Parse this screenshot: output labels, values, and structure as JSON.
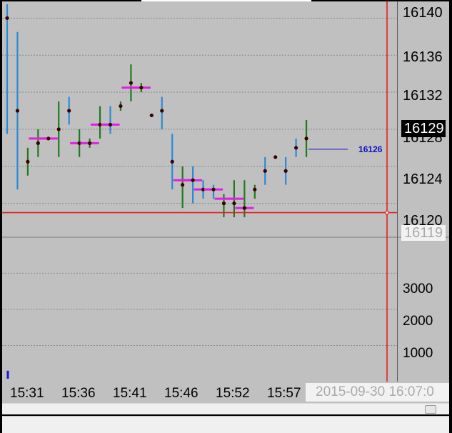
{
  "chart": {
    "price_axis_labels": [
      "16140",
      "16136",
      "16132",
      "16128",
      "16124",
      "16120"
    ],
    "volume_axis_labels": [
      "3000",
      "2000",
      "1000"
    ],
    "time_axis_labels": [
      "15:31",
      "15:36",
      "15:41",
      "15:46",
      "15:52",
      "15:57"
    ],
    "last_price_badge": "16129",
    "crosshair_price_badge": "16119",
    "crosshair_time_badge": "2015-09-30  16:07:0",
    "price_line_label": "16126",
    "colors": {
      "background": "#c0c0c0",
      "up_bar": "#1f7a1f",
      "down_bar": "#2a8ad8",
      "open_close_tick": "#e020e0",
      "crosshair": "#e02020",
      "price_line": "#1010c0",
      "grid": "#8a8a8a"
    }
  },
  "chart_data": {
    "type": "ohlc",
    "price_ylim": [
      16116.5,
      16141.8
    ],
    "price_gridlines": [
      16140,
      16136,
      16132,
      16128,
      16124,
      16120
    ],
    "volume_ylim": [
      0,
      3800
    ],
    "volume_gridlines": [
      3000,
      2000,
      1000
    ],
    "bars": [
      {
        "high": 16141.5,
        "low": 16127.5,
        "close": 16140.0,
        "dir": "down"
      },
      {
        "high": 16138.5,
        "low": 16121.5,
        "close": 16130.0,
        "dir": "down"
      },
      {
        "high": 16126.0,
        "low": 16123.0,
        "close": 16124.5,
        "dir": "up"
      },
      {
        "high": 16128.0,
        "low": 16125.0,
        "close": 16126.5,
        "dir": "up",
        "tick": 16127.0
      },
      {
        "high": 16127.0,
        "low": 16127.0,
        "close": 16127.0,
        "dir": "none",
        "tick": 16127.0
      },
      {
        "high": 16131.0,
        "low": 16125.0,
        "close": 16128.0,
        "dir": "up"
      },
      {
        "high": 16131.5,
        "low": 16128.5,
        "close": 16130.0,
        "dir": "down"
      },
      {
        "high": 16128.0,
        "low": 16125.0,
        "close": 16126.5,
        "dir": "up",
        "tick": 16126.5
      },
      {
        "high": 16127.0,
        "low": 16126.0,
        "close": 16126.5,
        "dir": "up",
        "tick": 16126.5
      },
      {
        "high": 16130.5,
        "low": 16127.0,
        "close": 16128.5,
        "dir": "up",
        "tick": 16128.5
      },
      {
        "high": 16130.5,
        "low": 16127.5,
        "close": 16128.5,
        "dir": "down",
        "tick": 16128.5
      },
      {
        "high": 16131.0,
        "low": 16130.0,
        "close": 16130.5,
        "dir": "up"
      },
      {
        "high": 16135.0,
        "low": 16131.0,
        "close": 16133.0,
        "dir": "up",
        "tick": 16132.5
      },
      {
        "high": 16133.0,
        "low": 16132.0,
        "close": 16132.5,
        "dir": "up",
        "tick": 16132.5
      },
      {
        "high": 16129.5,
        "low": 16129.5,
        "close": 16129.5,
        "dir": "none"
      },
      {
        "high": 16131.5,
        "low": 16128.0,
        "close": 16130.0,
        "dir": "down"
      },
      {
        "high": 16127.5,
        "low": 16121.5,
        "close": 16124.5,
        "dir": "down"
      },
      {
        "high": 16124.0,
        "low": 16119.5,
        "close": 16122.0,
        "dir": "up",
        "tick": 16122.5
      },
      {
        "high": 16124.0,
        "low": 16120.0,
        "close": 16122.5,
        "dir": "down",
        "tick": 16122.5
      },
      {
        "high": 16122.5,
        "low": 16120.5,
        "close": 16121.5,
        "dir": "down",
        "tick": 16121.5
      },
      {
        "high": 16122.0,
        "low": 16120.5,
        "close": 16121.5,
        "dir": "down",
        "tick": 16121.5
      },
      {
        "high": 16121.0,
        "low": 16118.5,
        "close": 16120.0,
        "dir": "up",
        "tick": 16120.5
      },
      {
        "high": 16122.5,
        "low": 16118.5,
        "close": 16120.0,
        "dir": "up",
        "tick": 16120.5
      },
      {
        "high": 16122.5,
        "low": 16118.5,
        "close": 16119.5,
        "dir": "up",
        "tick": 16119.5
      },
      {
        "high": 16122.0,
        "low": 16120.5,
        "close": 16121.5,
        "dir": "up"
      },
      {
        "high": 16125.0,
        "low": 16122.0,
        "close": 16123.5,
        "dir": "down"
      },
      {
        "high": 16125.0,
        "low": 16125.0,
        "close": 16125.0,
        "dir": "none"
      },
      {
        "high": 16125.0,
        "low": 16122.0,
        "close": 16123.5,
        "dir": "down"
      },
      {
        "high": 16127.0,
        "low": 16125.0,
        "close": 16126.0,
        "dir": "down"
      },
      {
        "high": 16129.0,
        "low": 16125.0,
        "close": 16127.0,
        "dir": "up"
      }
    ],
    "volume_bar_value": 300,
    "price_line_value": 16126,
    "crosshair_price": 16119,
    "crosshair_time": "2015-09-30 16:07"
  }
}
